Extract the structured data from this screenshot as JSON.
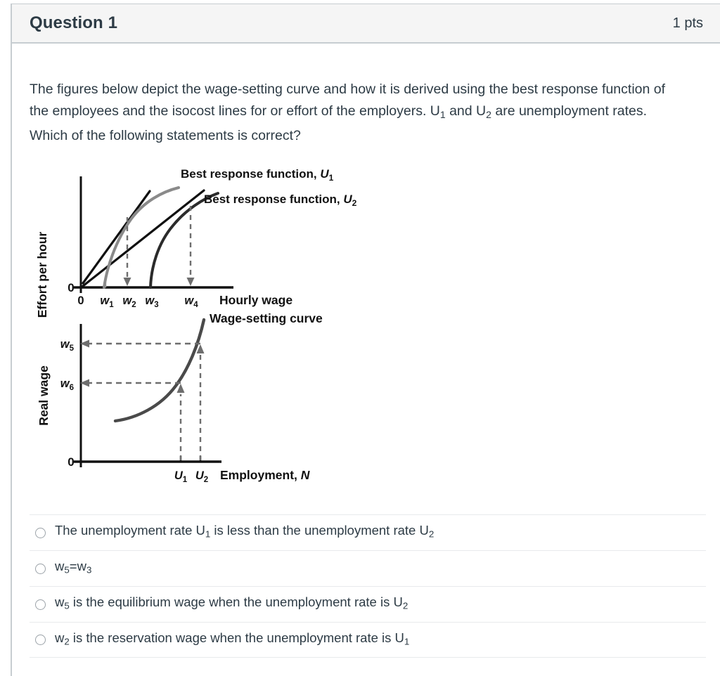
{
  "header": {
    "title": "Question 1",
    "points": "1 pts"
  },
  "question": {
    "text_part1": "The figures below depict the wage-setting curve and how it is derived using the best response function of the employees and the isocost lines for or effort of the employers. U",
    "sub1": "1",
    "text_part2": " and U",
    "sub2": "2",
    "text_part3": " are unemployment rates. Which of the following statements is correct?"
  },
  "chart_data": [
    {
      "type": "line",
      "title": "",
      "xlabel": "Hourly wage",
      "ylabel": "Effort per hour",
      "origin_label": "0",
      "origin_label_y": "0",
      "xticks": [
        "w1",
        "w2",
        "w3",
        "w4"
      ],
      "xtick_labels": [
        "w₁",
        "w₂",
        "w₃",
        "w₄"
      ],
      "xtick_positions": [
        148,
        180,
        212,
        270
      ],
      "grid": false,
      "legend_position": "top-right",
      "series": [
        {
          "name": "Best response function, U1",
          "label": "Best response function, U₁",
          "color": "#8a8a8a",
          "kind": "curve",
          "description": "Concave gray curve starting at w1 on the horizontal axis rising to the upper right"
        },
        {
          "name": "Best response function, U2",
          "label": "Best response function, U₂",
          "color": "#2b2b2b",
          "kind": "curve",
          "description": "Concave dark curve starting at w3 on the horizontal axis rising to the upper right"
        },
        {
          "name": "Isocost line tangent at w2",
          "label": "",
          "color": "#111111",
          "kind": "line",
          "description": "Steep straight isocost line from near origin tangent to the gray best response curve above w2"
        },
        {
          "name": "Isocost line tangent at w4",
          "label": "",
          "color": "#111111",
          "kind": "line",
          "description": "Flatter straight isocost line from near origin tangent to the dark best response curve above w4"
        }
      ],
      "annotations": [
        {
          "name": "dashed-arrow-w2",
          "from": "tangency on U1 curve",
          "to": "w2",
          "direction": "down"
        },
        {
          "name": "dashed-arrow-w4",
          "from": "tangency on U2 curve",
          "to": "w4",
          "direction": "down"
        }
      ]
    },
    {
      "type": "line",
      "title": "",
      "xlabel": "Employment, N",
      "ylabel": "Real wage",
      "origin_label": "0",
      "xticks": [
        "U1",
        "U2"
      ],
      "xtick_labels": [
        "U₁",
        "U₂"
      ],
      "yticks": [
        "w5",
        "w6"
      ],
      "ytick_labels": [
        "w₅",
        "w₆"
      ],
      "grid": false,
      "legend_position": "top-right",
      "series": [
        {
          "name": "Wage-setting curve",
          "label": "Wage-setting curve",
          "color": "#4a4a4a",
          "kind": "curve",
          "description": "Upward sloping convex curve rising steeply at the right"
        }
      ],
      "annotations": [
        {
          "name": "dashed-arrow-U1-up",
          "from": "U1",
          "to": "curve at w6",
          "direction": "up"
        },
        {
          "name": "dashed-arrow-U2-up",
          "from": "U2",
          "to": "curve at w5",
          "direction": "up"
        },
        {
          "name": "dashed-arrow-w6-left",
          "from": "curve at U1",
          "to": "w6",
          "direction": "left"
        },
        {
          "name": "dashed-arrow-w5-left",
          "from": "curve at U2",
          "to": "w5",
          "direction": "left"
        }
      ]
    }
  ],
  "answers": [
    {
      "id": "option-a",
      "pre": "The unemployment rate U",
      "sub_a": "1",
      "mid": " is less than the unemployment rate U",
      "sub_b": "2",
      "post": ""
    },
    {
      "id": "option-b",
      "pre": "w",
      "sub_a": "5",
      "mid": "=w",
      "sub_b": "3",
      "post": ""
    },
    {
      "id": "option-c",
      "pre": "w",
      "sub_a": "5",
      "mid": " is the equilibrium wage when the unemployment rate is U",
      "sub_b": "2",
      "post": ""
    },
    {
      "id": "option-d",
      "pre": "w",
      "sub_a": "2",
      "mid": " is the reservation wage when the unemployment rate is U",
      "sub_b": "1",
      "post": ""
    }
  ],
  "colors": {
    "header_bg": "#f5f5f5",
    "border": "#c7cdd1",
    "text": "#2d3b45",
    "gray_curve": "#8a8a8a",
    "dark_curve": "#2b2b2b",
    "ws_curve": "#4a4a4a",
    "dashed": "#6e6e6e"
  }
}
